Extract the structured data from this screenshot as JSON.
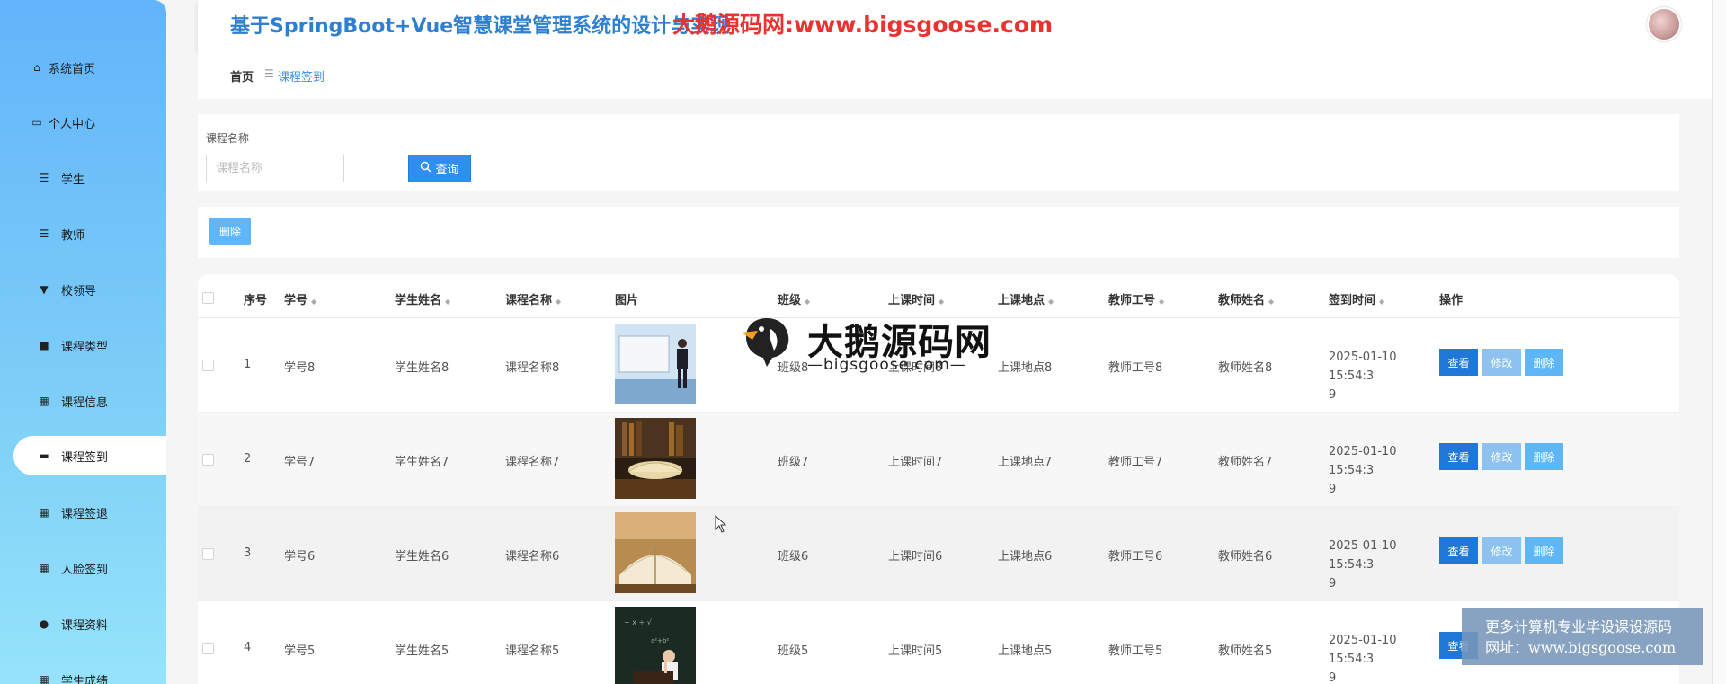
{
  "sidebar": {
    "items": [
      {
        "label": "系统首页",
        "icon": "home-icon"
      },
      {
        "label": "个人中心",
        "icon": "calendar-icon"
      },
      {
        "label": "学生",
        "icon": "menu-icon"
      },
      {
        "label": "教师",
        "icon": "menu-icon"
      },
      {
        "label": "校领导",
        "icon": "flag-icon"
      },
      {
        "label": "课程类型",
        "icon": "case-icon"
      },
      {
        "label": "课程信息",
        "icon": "grid-icon"
      },
      {
        "label": "课程签到",
        "icon": "monitor-icon"
      },
      {
        "label": "课程签退",
        "icon": "grid-icon"
      },
      {
        "label": "人脸签到",
        "icon": "grid-icon"
      },
      {
        "label": "课程资料",
        "icon": "user-icon"
      },
      {
        "label": "学生成绩",
        "icon": "grid-icon"
      }
    ],
    "active_index": 7
  },
  "header": {
    "title": "基于SpringBoot+Vue智慧课堂管理系统的设计与实现",
    "watermark": "大鹅源码网:www.bigsgoose.com"
  },
  "breadcrumb": {
    "home": "首页",
    "separator": "☰",
    "current": "课程签到"
  },
  "search": {
    "label": "课程名称",
    "placeholder": "课程名称",
    "button": "查询"
  },
  "actions": {
    "delete": "删除"
  },
  "table": {
    "headers": {
      "index": "序号",
      "student_no": "学号",
      "student_name": "学生姓名",
      "course_name": "课程名称",
      "image": "图片",
      "class": "班级",
      "class_time": "上课时间",
      "location": "上课地点",
      "teacher_no": "教师工号",
      "teacher_name": "教师姓名",
      "signin_time": "签到时间",
      "ops": "操作"
    },
    "rows": [
      {
        "index": "1",
        "student_no": "学号8",
        "student_name": "学生姓名8",
        "course_name": "课程名称8",
        "class": "班级8",
        "class_time": "上课时间8",
        "location": "上课地点8",
        "teacher_no": "教师工号8",
        "teacher_name": "教师姓名8",
        "signin_time_1": "2025-01-10 15:54:3",
        "signin_time_2": "9"
      },
      {
        "index": "2",
        "student_no": "学号7",
        "student_name": "学生姓名7",
        "course_name": "课程名称7",
        "class": "班级7",
        "class_time": "上课时间7",
        "location": "上课地点7",
        "teacher_no": "教师工号7",
        "teacher_name": "教师姓名7",
        "signin_time_1": "2025-01-10 15:54:3",
        "signin_time_2": "9"
      },
      {
        "index": "3",
        "student_no": "学号6",
        "student_name": "学生姓名6",
        "course_name": "课程名称6",
        "class": "班级6",
        "class_time": "上课时间6",
        "location": "上课地点6",
        "teacher_no": "教师工号6",
        "teacher_name": "教师姓名6",
        "signin_time_1": "2025-01-10 15:54:3",
        "signin_time_2": "9"
      },
      {
        "index": "4",
        "student_no": "学号5",
        "student_name": "学生姓名5",
        "course_name": "课程名称5",
        "class": "班级5",
        "class_time": "上课时间5",
        "location": "上课地点5",
        "teacher_no": "教师工号5",
        "teacher_name": "教师姓名5",
        "signin_time_1": "2025-01-10 15:54:3",
        "signin_time_2": "9"
      }
    ],
    "op_labels": {
      "view": "查看",
      "edit": "修改",
      "delete": "删除"
    }
  },
  "logo_watermark": {
    "main": "大鹅源码网",
    "sub": "—bigsgoose.com—"
  },
  "notice": {
    "line1": "更多计算机专业毕设课设源码",
    "line2": "网址：www.bigsgoose.com"
  },
  "colors": {
    "title": "#2f7fd1",
    "watermark": "#e8332f",
    "primary_button": "#2e8ef2",
    "sidebar_top": "#62b4fb",
    "sidebar_bottom": "#95e3fb"
  }
}
